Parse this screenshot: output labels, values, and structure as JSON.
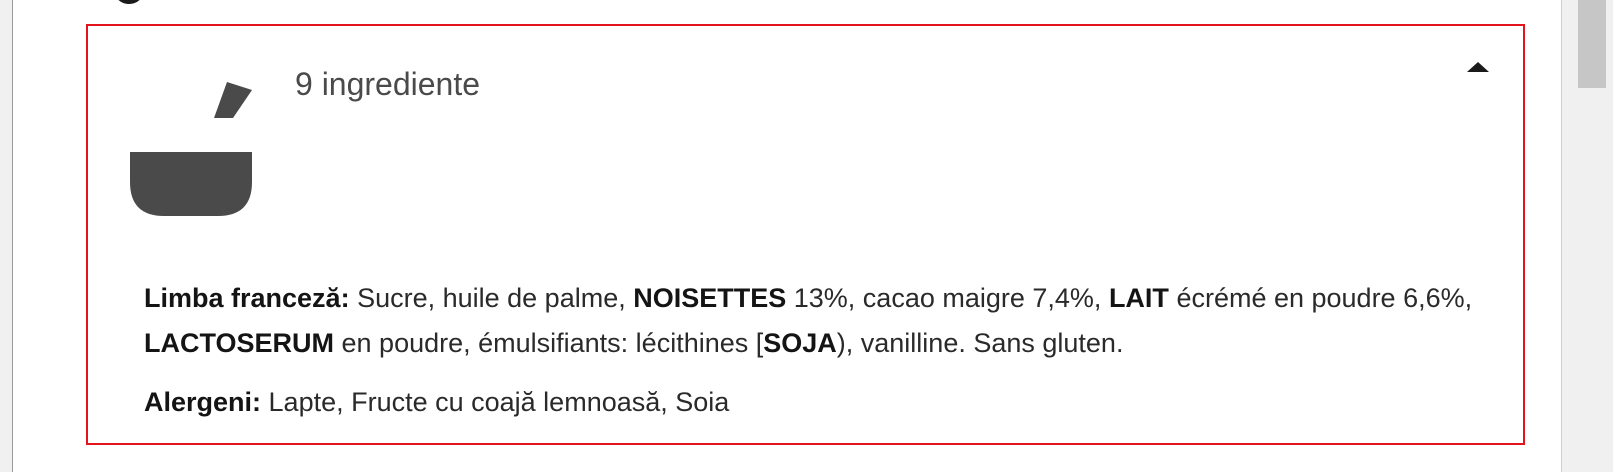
{
  "panel": {
    "ingredient_count": "9 ingrediente",
    "icon": "mortar-bowl-icon",
    "border_color": "#e3141c",
    "toggle_icon": "caret-up-icon"
  },
  "ingredients": {
    "label": "Limba franceză:",
    "parts": [
      " Sucre, huile de palme, ",
      "NOISETTES",
      " 13%, cacao maigre 7,4%, ",
      "LAIT",
      " écrémé en poudre 6,6%, ",
      "LACTOSERUM",
      " en poudre, émulsifiants: lécithines [",
      "SOJA",
      "), vanilline. Sans gluten."
    ]
  },
  "allergens": {
    "label": "Alergeni:",
    "value": " Lapte, Fructe cu coajă lemnoasă, Soia"
  }
}
